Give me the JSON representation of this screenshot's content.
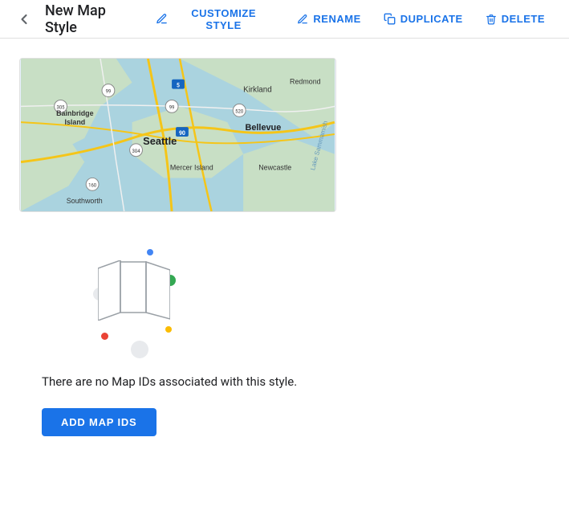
{
  "toolbar": {
    "back_icon": "←",
    "title": "New Map Style",
    "buttons": [
      {
        "id": "customize",
        "label": "CUSTOMIZE STYLE",
        "icon": "pencil"
      },
      {
        "id": "rename",
        "label": "RENAME",
        "icon": "pencil"
      },
      {
        "id": "duplicate",
        "label": "DUPLICATE",
        "icon": "duplicate"
      },
      {
        "id": "delete",
        "label": "DELETE",
        "icon": "trash"
      }
    ]
  },
  "empty_state": {
    "message": "There are no Map IDs associated with this style.",
    "add_button_label": "ADD MAP IDS"
  },
  "colors": {
    "primary": "#1a73e8",
    "text": "#202124",
    "muted": "#5f6368"
  }
}
